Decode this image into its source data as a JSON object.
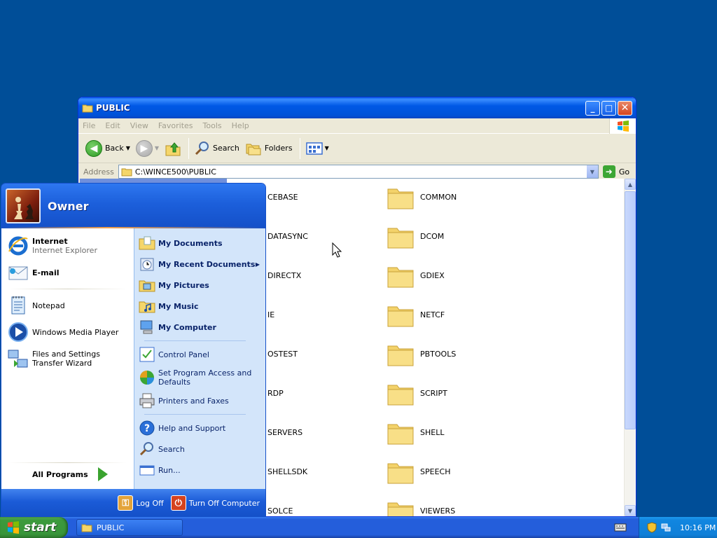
{
  "window": {
    "title": "PUBLIC",
    "menu": [
      "File",
      "Edit",
      "View",
      "Favorites",
      "Tools",
      "Help"
    ],
    "toolbar": {
      "back": "Back",
      "search": "Search",
      "folders": "Folders"
    },
    "address": {
      "label": "Address",
      "path": "C:\\WINCE500\\PUBLIC",
      "go": "Go"
    },
    "folders_left": [
      "CEBASE",
      "DATASYNC",
      "DIRECTX",
      "IE",
      "OSTEST",
      "RDP",
      "SERVERS",
      "SHELLSDK",
      "SOLCE"
    ],
    "folders_right": [
      "COMMON",
      "DCOM",
      "GDIEX",
      "NETCF",
      "PBTOOLS",
      "SCRIPT",
      "SHELL",
      "SPEECH",
      "VIEWERS"
    ]
  },
  "start_menu": {
    "user": "Owner",
    "pinned": [
      {
        "title": "Internet",
        "subtitle": "Internet Explorer"
      },
      {
        "title": "E-mail",
        "subtitle": ""
      }
    ],
    "recent": [
      "Notepad",
      "Windows Media Player",
      "Files and Settings Transfer Wizard"
    ],
    "all_programs": "All Programs",
    "right_places": [
      "My Documents",
      "My Recent Documents",
      "My Pictures",
      "My Music",
      "My Computer"
    ],
    "right_settings": [
      "Control Panel",
      "Set Program Access and Defaults",
      "Printers and Faxes"
    ],
    "right_help": [
      "Help and Support",
      "Search",
      "Run..."
    ],
    "log_off": "Log Off",
    "turn_off": "Turn Off Computer"
  },
  "taskbar": {
    "start": "start",
    "task": "PUBLIC",
    "clock": "10:16 PM"
  }
}
